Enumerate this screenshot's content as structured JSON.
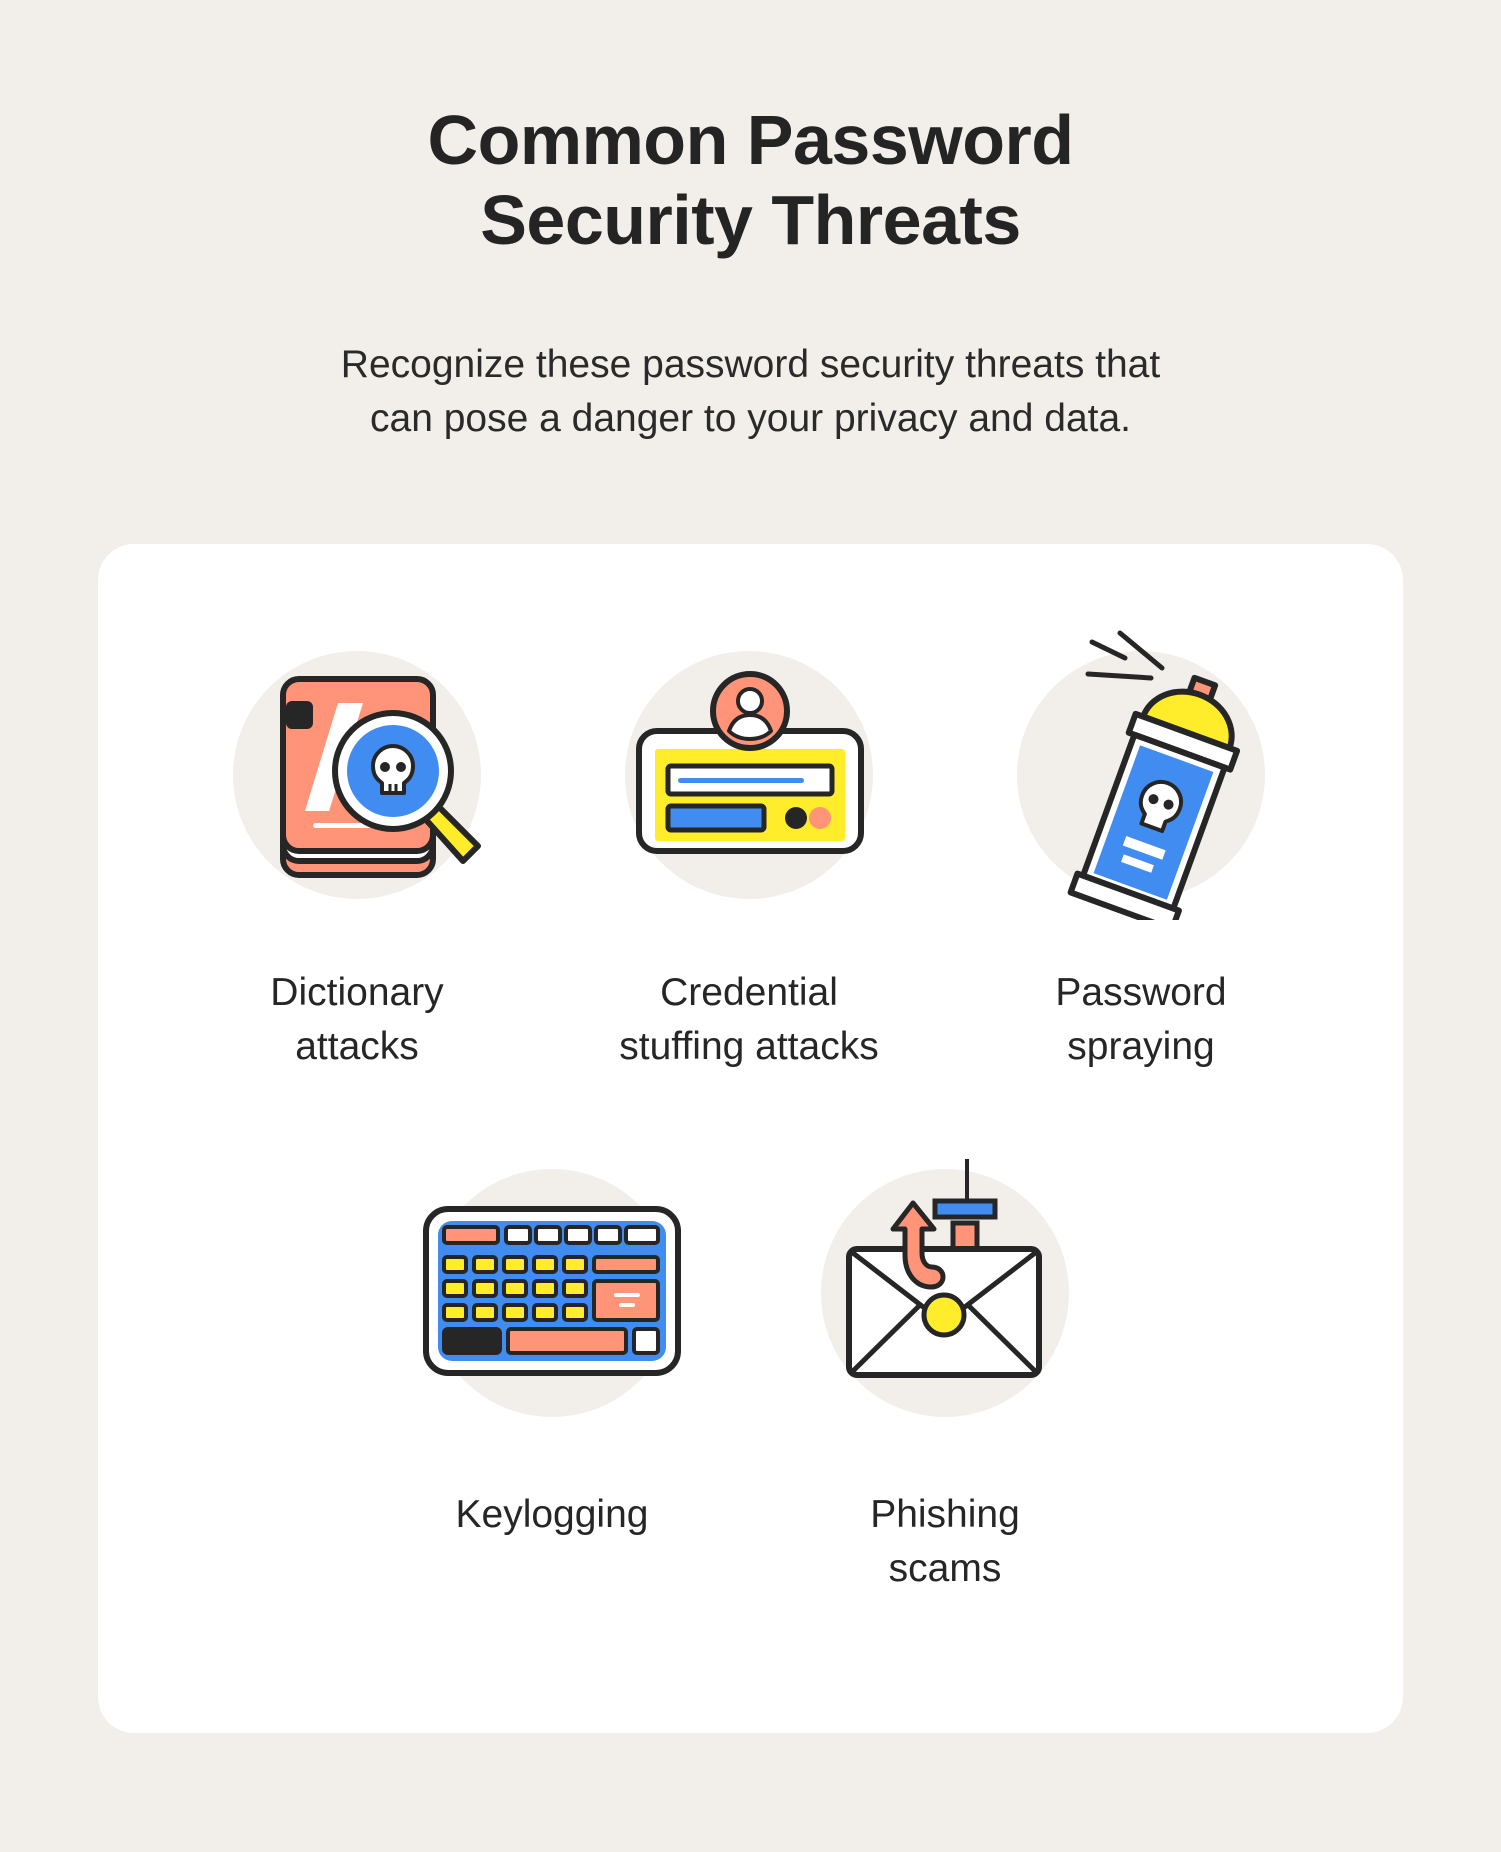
{
  "header": {
    "title_line1": "Common Password",
    "title_line2": "Security Threats",
    "subtitle_line1": "Recognize these password security threats that",
    "subtitle_line2": "can pose a danger to your privacy and data."
  },
  "colors": {
    "background": "#f2efea",
    "card": "#ffffff",
    "outline": "#262626",
    "salmon": "#ff9479",
    "blue": "#418cf0",
    "yellow": "#ffec2a"
  },
  "threats": [
    {
      "icon": "book-magnifier-skull-icon",
      "line1": "Dictionary",
      "line2": "attacks"
    },
    {
      "icon": "login-card-user-icon",
      "line1": "Credential",
      "line2": "stuffing attacks"
    },
    {
      "icon": "spray-can-skull-icon",
      "line1": "Password",
      "line2": "spraying"
    },
    {
      "icon": "keyboard-icon",
      "line1": "Keylogging",
      "line2": ""
    },
    {
      "icon": "envelope-hook-icon",
      "line1": "Phishing",
      "line2": "scams"
    }
  ]
}
